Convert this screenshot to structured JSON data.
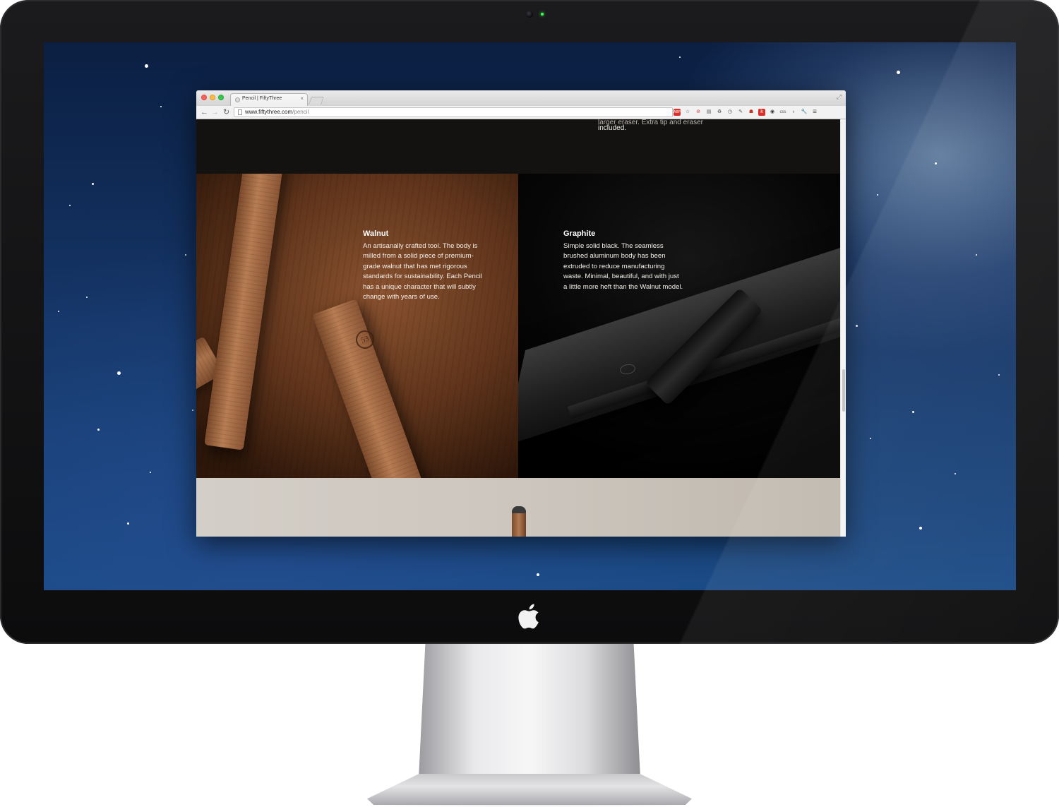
{
  "browser": {
    "tab": {
      "title": "Pencil | FiftyThree",
      "close_icon": "×"
    },
    "address": {
      "host": "www.fiftythree.com",
      "path": "/pencil"
    },
    "nav": {
      "back_icon": "←",
      "forward_icon": "→",
      "reload_icon": "↻"
    },
    "fullscreen_icon": "⤢",
    "extensions": [
      "ABP",
      "☆",
      "⊘",
      "▤",
      "♻",
      "◷",
      "✎",
      "☗",
      "k",
      "◉",
      "css",
      "♁",
      "🔧",
      "≡"
    ]
  },
  "page": {
    "top_text": {
      "cut_line": "larger eraser. Extra tip and eraser",
      "line": "included."
    },
    "walnut": {
      "title": "Walnut",
      "body": "An artisanally crafted tool. The body is milled from a solid piece of premium-grade walnut that has met rigorous standards for sustainability. Each Pencil has a unique character that will subtly change with years of use.",
      "logo_mark": "53"
    },
    "graphite": {
      "title": "Graphite",
      "body": "Simple solid black. The seamless brushed aluminum body has been extruded to reduce manufacturing waste. Minimal, beautiful, and with just a little more heft than the Walnut model."
    }
  },
  "colors": {
    "bezel": "#111111",
    "desktop": "#143363",
    "page_dark": "#131211",
    "walnut": "#8a5230",
    "band": "#ccc6be"
  }
}
